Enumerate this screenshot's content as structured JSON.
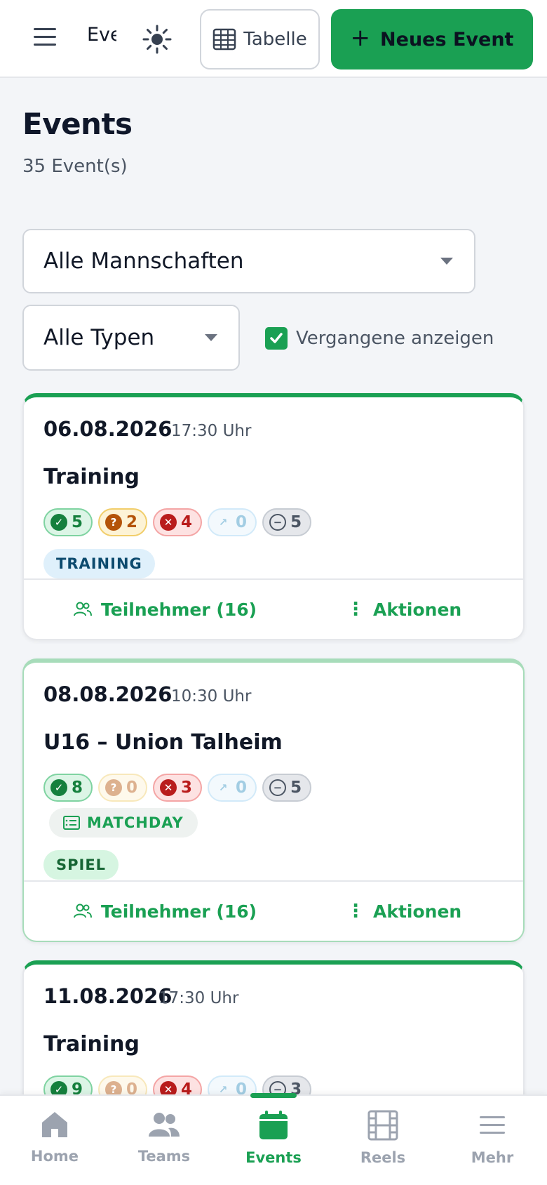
{
  "header": {
    "app_title": "Events",
    "table_label": "Tabelle",
    "new_event_label": "Neues Event"
  },
  "page": {
    "title": "Events",
    "count": "35 Event(s)"
  },
  "filters": {
    "team": "Alle Mannschaften",
    "type": "Alle Typen",
    "show_past_label": "Vergangene anzeigen",
    "show_past_checked": true
  },
  "events": [
    {
      "date": "06.08.2026",
      "time": "17:30 Uhr",
      "title": "Training",
      "yes": "5",
      "maybe": "2",
      "no": "4",
      "external": "0",
      "none": "5",
      "tag": "TRAINING",
      "participants": "Teilnehmer (16)",
      "actions": "Aktionen"
    },
    {
      "date": "08.08.2026",
      "time": "10:30 Uhr",
      "title": "U16 – Union Talheim",
      "yes": "8",
      "maybe": "0",
      "no": "3",
      "external": "0",
      "none": "5",
      "matchday": "MATCHDAY",
      "tag": "SPIEL",
      "participants": "Teilnehmer (16)",
      "actions": "Aktionen"
    },
    {
      "date": "11.08.2026",
      "time": "17:30 Uhr",
      "title": "Training",
      "yes": "9",
      "maybe": "0",
      "no": "4",
      "external": "0",
      "none": "3"
    }
  ],
  "nav": {
    "home": "Home",
    "teams": "Teams",
    "events": "Events",
    "reels": "Reels",
    "more": "Mehr",
    "active": "events"
  },
  "colors": {
    "accent": "#1aa053",
    "yes": "#15803d",
    "maybe": "#b45309",
    "no": "#b91c1c"
  }
}
